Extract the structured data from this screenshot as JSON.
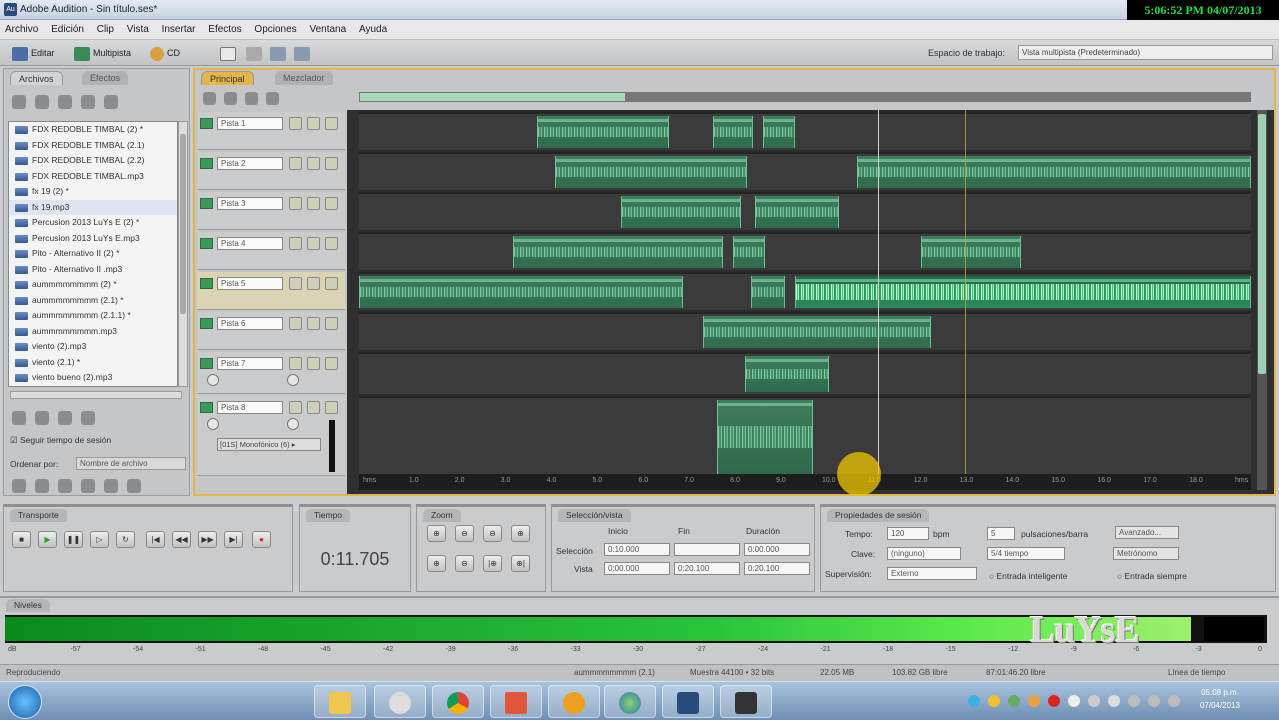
{
  "window": {
    "title": "Adobe Audition - Sin título.ses*",
    "clock": "5:06:52 PM 04/07/2013"
  },
  "menu": [
    "Archivo",
    "Edición",
    "Clip",
    "Vista",
    "Insertar",
    "Efectos",
    "Opciones",
    "Ventana",
    "Ayuda"
  ],
  "toolbar": {
    "edit_label": "Editar",
    "multitrack_label": "Multipista",
    "cd_label": "CD",
    "workspace_label": "Espacio de trabajo:",
    "workspace_value": "Vista multipista (Predeterminado)"
  },
  "files_panel": {
    "tabs": [
      "Archivos",
      "Efectos"
    ],
    "items": [
      "FDX REDOBLE TIMBAL (2) *",
      "FDX REDOBLE TIMBAL (2.1)",
      "FDX REDOBLE TIMBAL (2.2)",
      "FDX REDOBLE TIMBAL.mp3",
      "fx 19 (2) *",
      "fx 19.mp3",
      "Percusion 2013 LuYs E (2) *",
      "Percusion 2013 LuYs E.mp3",
      "Pito - Alternativo II (2) *",
      "Pito - Alternativo II .mp3",
      "aummmmmmmm (2) *",
      "aummmmmmmm (2.1) *",
      "aummmmmmmm (2.1.1) *",
      "aummmmmmmm.mp3",
      "viento (2).mp3",
      "viento (2.1) *",
      "viento bueno (2).mp3"
    ],
    "selected_index": 5,
    "follow_label": "Seguir tiempo de sesión",
    "sort_label": "Ordenar por:",
    "sort_value": "Nombre de archivo"
  },
  "main_panel": {
    "tabs": [
      "Principal",
      "Mezclador"
    ],
    "tracks": [
      {
        "name": "Pista 1"
      },
      {
        "name": "Pista 2"
      },
      {
        "name": "Pista 3"
      },
      {
        "name": "Pista 4"
      },
      {
        "name": "Pista 5"
      },
      {
        "name": "Pista 6"
      },
      {
        "name": "Pista 7"
      },
      {
        "name": "Pista 8"
      }
    ],
    "master_label": "[01S] Monofónico (6) ▸",
    "timeline_labels": [
      "hms",
      "1.0",
      "2.0",
      "3.0",
      "4.0",
      "5.0",
      "6.0",
      "7.0",
      "8.0",
      "9.0",
      "10.0",
      "11.0",
      "12.0",
      "13.0",
      "14.0",
      "15.0",
      "16.0",
      "17.0",
      "18.0",
      "hms"
    ]
  },
  "transport": {
    "title": "Transporte"
  },
  "time": {
    "title": "Tiempo",
    "value": "0:11.705"
  },
  "zoom": {
    "title": "Zoom"
  },
  "selection": {
    "title": "Selección/vista",
    "col_start": "Inicio",
    "col_end": "Fin",
    "col_duration": "Duración",
    "row_selection": "Selección",
    "row_view": "Vista",
    "sel_start": "0:10.000",
    "sel_end": "",
    "sel_duration": "0:00.000",
    "view_start": "0:00.000",
    "view_end": "0:20.100",
    "view_duration": "0:20.100"
  },
  "session": {
    "title": "Propiedades de sesión",
    "tempo_label": "Tempo:",
    "tempo_value": "120",
    "bpm": "bpm",
    "beats_value": "5",
    "beats_label": "pulsaciones/barra",
    "advanced": "Avanzado...",
    "key_label": "Clave:",
    "key_value": "(ninguno)",
    "time_sig": "5/4 tiempo",
    "metronome": "Metrónomo",
    "sync_label": "Supervisión:",
    "sync_value": "Externo",
    "smart_input": "Entrada inteligente",
    "always_input": "Entrada siempre"
  },
  "levels": {
    "title": "Niveles",
    "watermark": "LuYsE",
    "fill_fraction": 0.94,
    "scale": [
      "dB",
      "-57",
      "-54",
      "-51",
      "-48",
      "-45",
      "-42",
      "-39",
      "-36",
      "-33",
      "-30",
      "-27",
      "-24",
      "-21",
      "-18",
      "-15",
      "-12",
      "-9",
      "-6",
      "-3",
      "0"
    ]
  },
  "status": {
    "left": "Reproduciendo",
    "file": "aummmmmmmm (2.1)",
    "format": "Muestra 44100 • 32 bits",
    "size": "22.05 MB",
    "free": "103.82 GB libre",
    "free_time": "87:01:46.20 libre",
    "right": "Línea de tiempo"
  },
  "taskbar": {
    "time": "05:08 p.m.",
    "date": "07/04/2013"
  },
  "colors": {
    "accent": "#e3b54a",
    "clip": "#3f7d5d",
    "clock_text": "#1de04a"
  }
}
